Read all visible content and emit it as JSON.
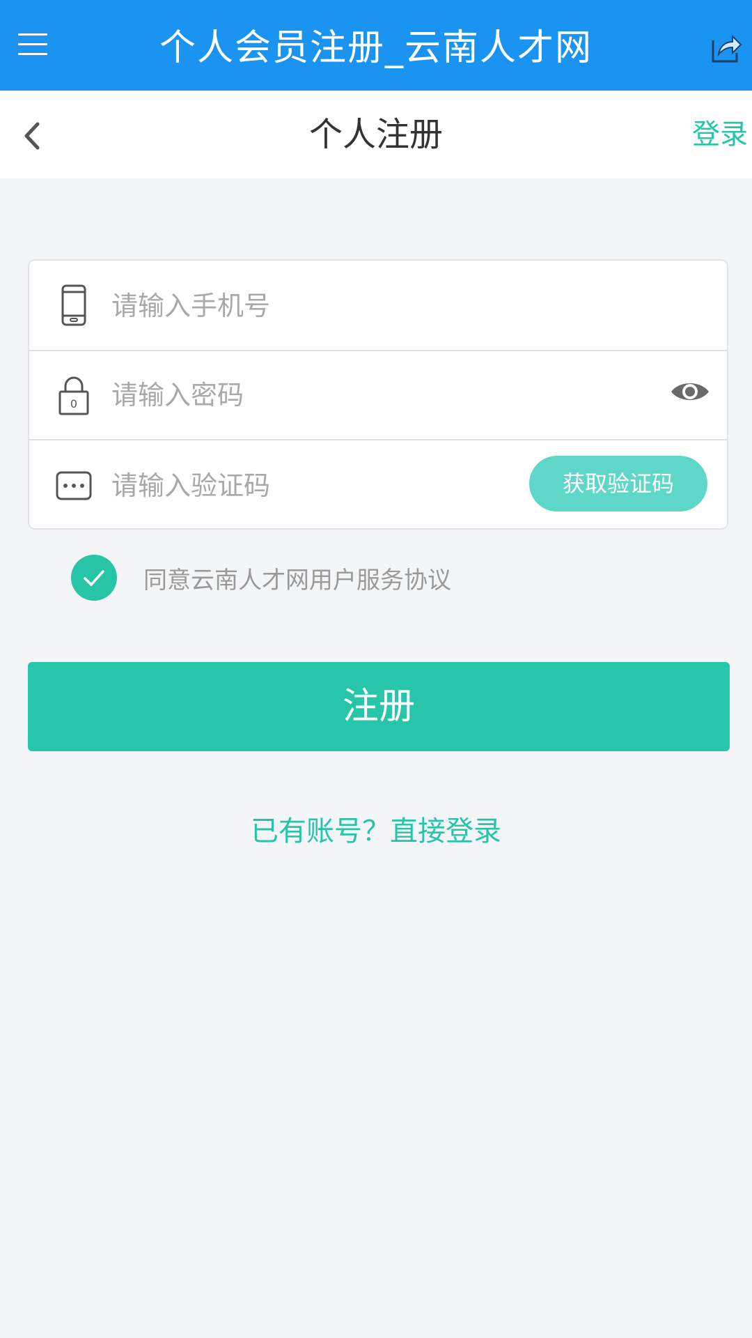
{
  "app_bar": {
    "title": "个人会员注册_云南人才网"
  },
  "sub_header": {
    "title": "个人注册",
    "login_link": "登录"
  },
  "form": {
    "phone_placeholder": "请输入手机号",
    "password_placeholder": "请输入密码",
    "code_placeholder": "请输入验证码",
    "get_code_button": "获取验证码"
  },
  "agreement": {
    "checked": true,
    "text": "同意云南人才网用户服务协议"
  },
  "register_button": "注册",
  "have_account_link": "已有账号？直接登录",
  "colors": {
    "app_bar": "#1a94f0",
    "accent": "#27c4a8",
    "code_button": "#5ed6c8",
    "background": "#f4f5f7"
  },
  "icons": [
    "menu-icon",
    "share-icon",
    "back-icon",
    "phone-icon",
    "lock-icon",
    "eye-icon",
    "code-dots-icon",
    "check-icon"
  ]
}
